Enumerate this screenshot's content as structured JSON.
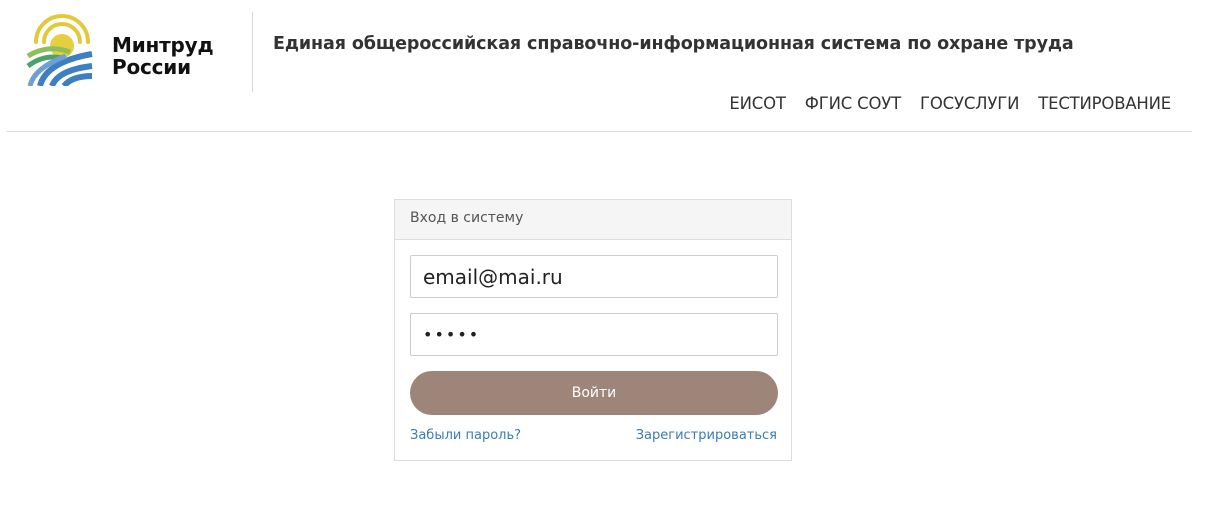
{
  "header": {
    "brand_line1": "Минтруд",
    "brand_line2": "России",
    "site_title": "Единая общероссийская справочно-информационная система по охране труда",
    "nav": [
      {
        "label": "ЕИСОТ"
      },
      {
        "label": "ФГИС СОУТ"
      },
      {
        "label": "ГОСУСЛУГИ"
      },
      {
        "label": "ТЕСТИРОВАНИЕ"
      }
    ]
  },
  "login": {
    "panel_title": "Вход в систему",
    "email_value": "email@mai.ru",
    "password_value": "•••••",
    "submit_label": "Войти",
    "forgot_label": "Забыли пароль?",
    "register_label": "Зарегистрироваться"
  },
  "colors": {
    "button": "#9d8679",
    "link": "#3a7db0",
    "logo_yellow": "#e3c93a",
    "logo_green": "#8fbf5a",
    "logo_blue": "#3d7fc1"
  }
}
